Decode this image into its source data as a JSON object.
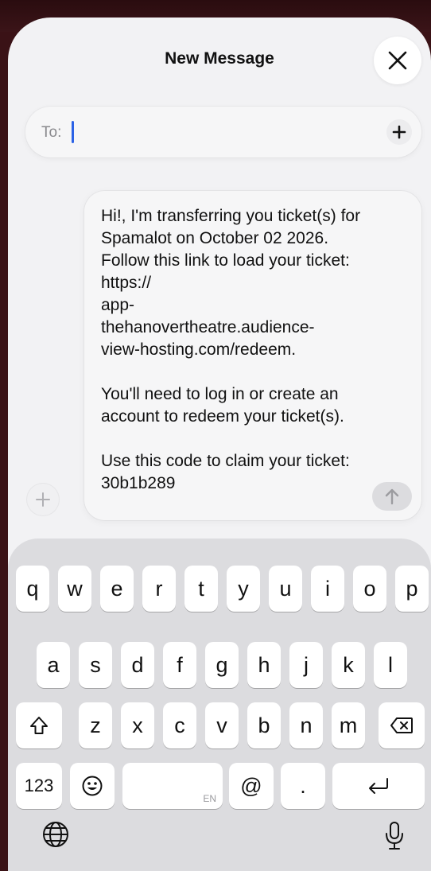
{
  "header": {
    "title": "New Message",
    "close_icon": "close-icon"
  },
  "to_field": {
    "label": "To:",
    "value": "",
    "add_icon": "plus-icon"
  },
  "compose": {
    "message": "Hi!, I'm transferring you ticket(s) for Spamalot on October 02 2026. Follow this link to load your ticket: https://\napp-\nthehanovertheatre.audience-\nview-hosting.com/redeem.\n\nYou'll need to log in or create an account to redeem your ticket(s).\n\nUse this code to claim your ticket: 30b1b289",
    "attach_icon": "plus-icon",
    "send_icon": "arrow-up-icon"
  },
  "keyboard": {
    "row1": [
      "q",
      "w",
      "e",
      "r",
      "t",
      "y",
      "u",
      "i",
      "o",
      "p"
    ],
    "row2": [
      "a",
      "s",
      "d",
      "f",
      "g",
      "h",
      "j",
      "k",
      "l"
    ],
    "row3": [
      "z",
      "x",
      "c",
      "v",
      "b",
      "n",
      "m"
    ],
    "numbers_key": "123",
    "at_key": "@",
    "period_key": ".",
    "space_hint": "EN",
    "shift_icon": "shift-icon",
    "delete_icon": "delete-icon",
    "emoji_icon": "emoji-icon",
    "return_icon": "return-icon",
    "globe_icon": "globe-icon",
    "mic_icon": "microphone-icon"
  }
}
